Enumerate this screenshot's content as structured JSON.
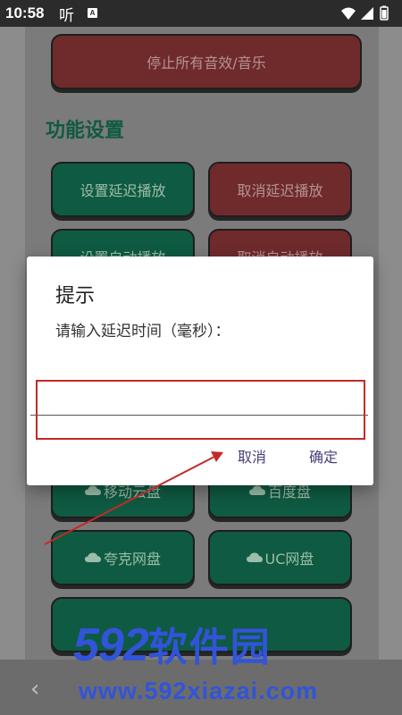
{
  "statusbar": {
    "time": "10:58",
    "app_icon": "听",
    "notification_icon": "A"
  },
  "buttons": {
    "stop_all": "停止所有音效/音乐",
    "set_delay": "设置延迟播放",
    "cancel_delay": "取消延迟播放",
    "set_auto": "设置自动播放",
    "cancel_auto": "取消自动播放",
    "mobile_cloud": "移动云盘",
    "baidu": "百度盘",
    "quark": "夸克网盘",
    "uc": "UC网盘"
  },
  "section": {
    "title": "功能设置"
  },
  "dialog": {
    "title": "提示",
    "message": "请输入延迟时间（毫秒）：",
    "input_value": "",
    "cancel": "取消",
    "confirm": "确定"
  },
  "watermark": {
    "number": "592",
    "name": "软件园",
    "url": "www.592xiazai.com"
  },
  "colors": {
    "green_button": "#0f5a42",
    "red_button": "#6f2a2c",
    "annotation": "#c62828",
    "dialog_accent": "#4a3d7c",
    "watermark": "#3154d8"
  }
}
